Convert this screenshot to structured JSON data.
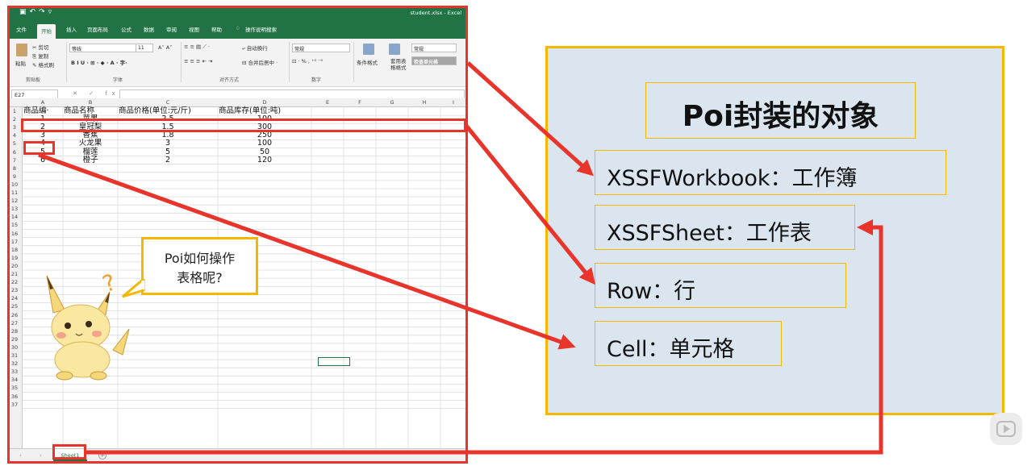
{
  "excel": {
    "file_title": "student.xlsx - Excel",
    "tabs": [
      "文件",
      "开始",
      "插入",
      "页面布局",
      "公式",
      "数据",
      "审阅",
      "视图",
      "帮助",
      "操作说明搜索"
    ],
    "active_tab_index": 1,
    "ribbon": {
      "cut": "剪切",
      "copy": "复制",
      "format_painter": "格式刷",
      "paste": "粘贴",
      "clipboard_group": "剪贴板",
      "font_name": "等线",
      "font_size": "11",
      "font_group": "字体",
      "wrap_text": "自动换行",
      "merge_center": "合并后居中",
      "align_group": "对齐方式",
      "number_format": "常规",
      "number_group": "数字",
      "conditional_format": "条件格式",
      "table_format": "套用表格格式",
      "style_normal": "常规",
      "style_check": "检查单元格"
    },
    "name_box": "E27",
    "fx_label": "fx",
    "columns": [
      "A",
      "B",
      "C",
      "D",
      "E",
      "F",
      "G",
      "H",
      "I"
    ],
    "row_count": 37,
    "header_row": [
      "商品编号",
      "商品名称",
      "商品价格(单位:元/斤)",
      "商品库存(单位:吨)"
    ],
    "header_row_display": [
      "商品编·",
      "商品名称",
      "商品价格(单位:元/斤)",
      "商品库存(单位:吨)"
    ],
    "rows": [
      [
        "1",
        "苹果",
        "2.5",
        "100"
      ],
      [
        "2",
        "皇冠梨",
        "1.5",
        "300"
      ],
      [
        "3",
        "香蕉",
        "1.8",
        "250"
      ],
      [
        "4",
        "火龙果",
        "3",
        "100"
      ],
      [
        "5",
        "榴莲",
        "5",
        "50"
      ],
      [
        "6",
        "橙子",
        "2",
        "120"
      ]
    ],
    "sheet_tab": "Sheet1"
  },
  "bubble": {
    "line1": "Poi如何操作",
    "line2": "表格呢?"
  },
  "panel": {
    "title": "Poi封装的对象",
    "items": [
      "XSSFWorkbook：工作簿",
      "XSSFSheet：工作表",
      "Row：行",
      "Cell：单元格"
    ]
  },
  "colors": {
    "excel_green": "#217346",
    "highlight_red": "#e8342a",
    "accent_yellow": "#f5b800",
    "panel_bg": "#dbe5ef"
  },
  "icons": [
    "save-icon",
    "undo-icon",
    "redo-icon",
    "lightbulb-icon",
    "paste-icon",
    "play-icon",
    "pikachu-mascot"
  ]
}
